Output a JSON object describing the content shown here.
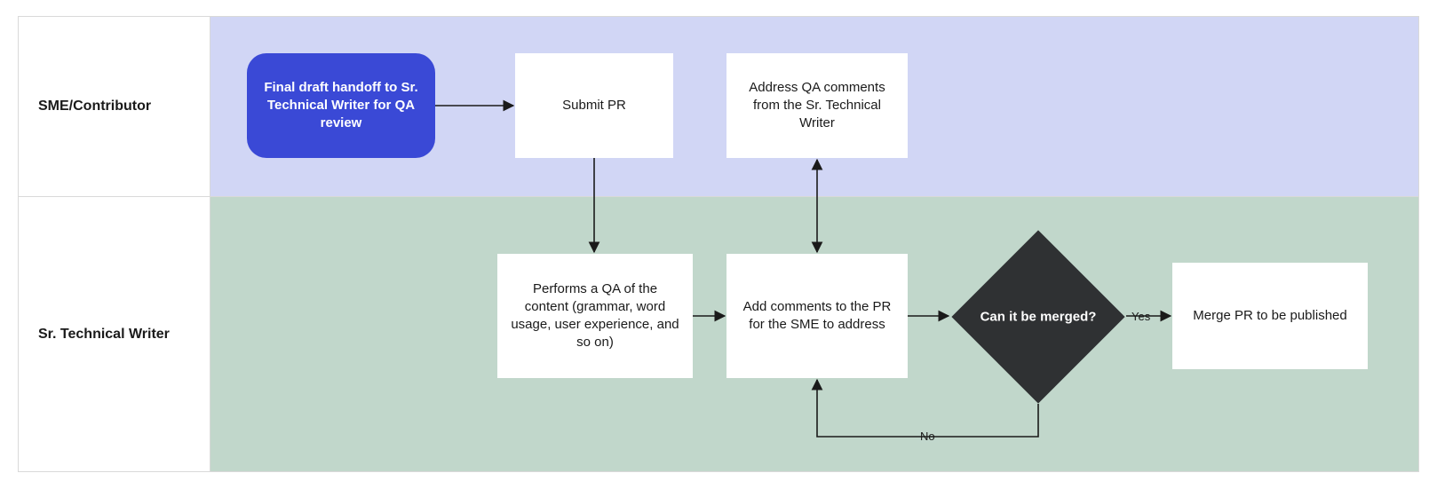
{
  "lanes": {
    "top": "SME/Contributor",
    "bottom": "Sr. Technical Writer"
  },
  "nodes": {
    "start": "Final draft handoff to Sr. Technical Writer for QA review",
    "submit": "Submit PR",
    "address": "Address QA comments from the Sr. Technical Writer",
    "qa": "Performs a QA of the content (grammar, word usage, user experience, and so on)",
    "comments": "Add comments to the PR for the SME to address",
    "decision": "Can it be merged?",
    "merge": "Merge PR to be published"
  },
  "edges": {
    "yes": "Yes",
    "no": "No"
  }
}
